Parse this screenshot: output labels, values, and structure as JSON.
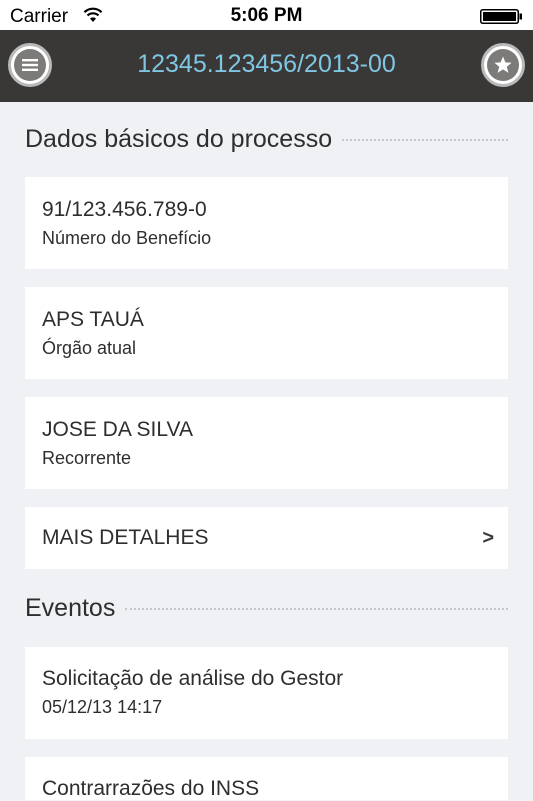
{
  "status_bar": {
    "carrier": "Carrier",
    "time": "5:06 PM"
  },
  "nav": {
    "title": "12345.123456/2013-00",
    "left_icon": "menu-icon",
    "right_icon": "star-icon",
    "title_color": "#7fc6e3",
    "bar_color": "#3a3836"
  },
  "sections": {
    "basic": {
      "title": "Dados básicos do processo",
      "items": [
        {
          "value": "91/123.456.789-0",
          "label": "Número do Benefício"
        },
        {
          "value": "APS TAUÁ",
          "label": "Órgão atual"
        },
        {
          "value": "JOSE DA SILVA",
          "label": "Recorrente"
        }
      ],
      "more_label": "MAIS DETALHES",
      "more_chevron": ">"
    },
    "events": {
      "title": "Eventos",
      "items": [
        {
          "title": "Solicitação de análise do Gestor",
          "date": "05/12/13 14:17"
        },
        {
          "title": "Contrarrazões do INSS",
          "date": ""
        }
      ]
    }
  }
}
